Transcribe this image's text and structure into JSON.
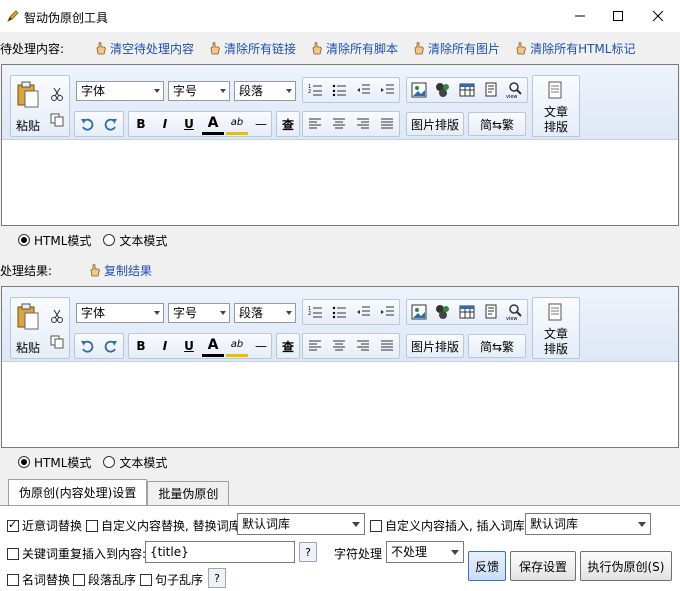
{
  "window": {
    "title": "智动伪原创工具"
  },
  "input_section": {
    "label": "待处理内容:",
    "actions": [
      "清空待处理内容",
      "清除所有链接",
      "清除所有脚本",
      "清除所有图片",
      "清除所有HTML标记"
    ]
  },
  "output_section": {
    "label": "处理结果:",
    "actions": [
      "复制结果"
    ]
  },
  "editor": {
    "paste_label": "粘贴",
    "font_value": "字体",
    "size_value": "字号",
    "format_value": "段落",
    "bold": "B",
    "italic": "I",
    "underline": "U",
    "fontcolor": "A",
    "highlight": "ab",
    "hr": "—",
    "find": "查",
    "image_layout": "图片排版",
    "convert": "简⇆繁",
    "article_layout_1": "文章",
    "article_layout_2": "排版",
    "view": "view"
  },
  "mode": {
    "html": "HTML模式",
    "text": "文本模式"
  },
  "tabs": [
    "伪原创(内容处理)设置",
    "批量伪原创"
  ],
  "settings": {
    "synonym": "近意词替换",
    "custom_replace": "自定义内容替换, 替换词库:",
    "replace_lib": "默认词库",
    "custom_insert": "自定义内容插入, 插入词库:",
    "insert_lib": "默认词库",
    "keyword_insert": "关键词重复插入到内容:",
    "keyword_value": "{title}",
    "char_label": "字符处理",
    "char_value": "不处理",
    "noun": "名词替换",
    "para_shuffle": "段落乱序",
    "sentence_shuffle": "句子乱序",
    "help": "?"
  },
  "buttons": {
    "feedback": "反馈",
    "save": "保存设置",
    "run": "执行伪原创(S)"
  }
}
